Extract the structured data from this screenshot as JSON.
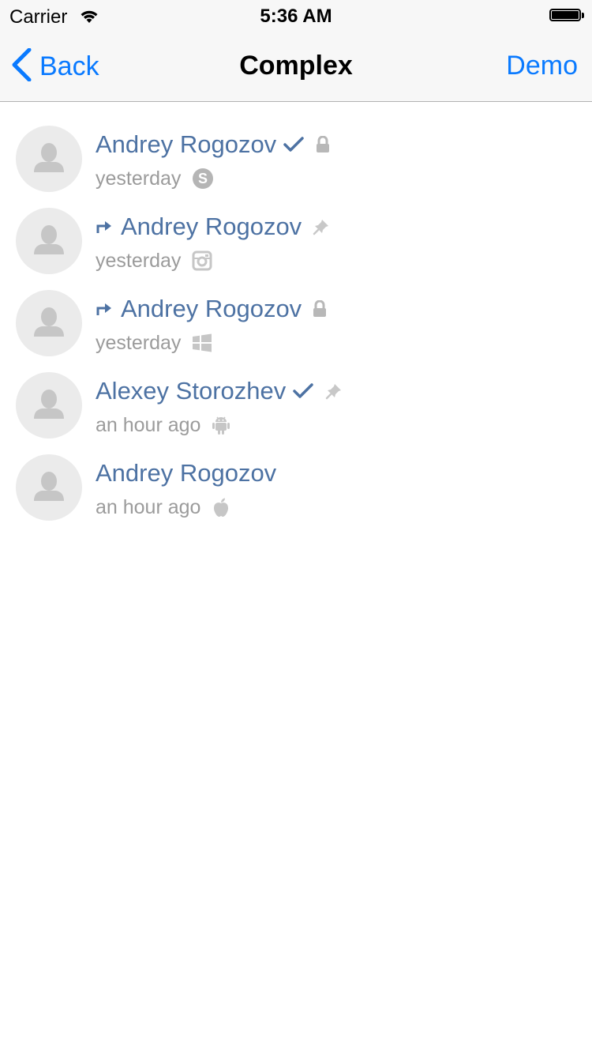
{
  "status_bar": {
    "carrier": "Carrier",
    "time": "5:36 AM"
  },
  "nav": {
    "back_label": "Back",
    "title": "Complex",
    "right_label": "Demo"
  },
  "rows": [
    {
      "name": "Andrey Rogozov",
      "time": "yesterday",
      "forwarded": false,
      "checked": true,
      "status_icon": "lock-icon",
      "platform_icon": "skype-icon"
    },
    {
      "name": "Andrey Rogozov",
      "time": "yesterday",
      "forwarded": true,
      "checked": false,
      "status_icon": "pin-icon",
      "platform_icon": "instagram-icon"
    },
    {
      "name": "Andrey Rogozov",
      "time": "yesterday",
      "forwarded": true,
      "checked": false,
      "status_icon": "lock-icon",
      "platform_icon": "windows-icon"
    },
    {
      "name": "Alexey Storozhev",
      "time": "an hour ago",
      "forwarded": false,
      "checked": true,
      "status_icon": "pin-icon",
      "platform_icon": "android-icon"
    },
    {
      "name": "Andrey Rogozov",
      "time": "an hour ago",
      "forwarded": false,
      "checked": false,
      "status_icon": "",
      "platform_icon": "apple-icon"
    }
  ],
  "colors": {
    "accent": "#0a7aff",
    "name": "#4d72a3",
    "secondary": "#9b9b9b",
    "avatar_bg": "#ebebeb"
  }
}
